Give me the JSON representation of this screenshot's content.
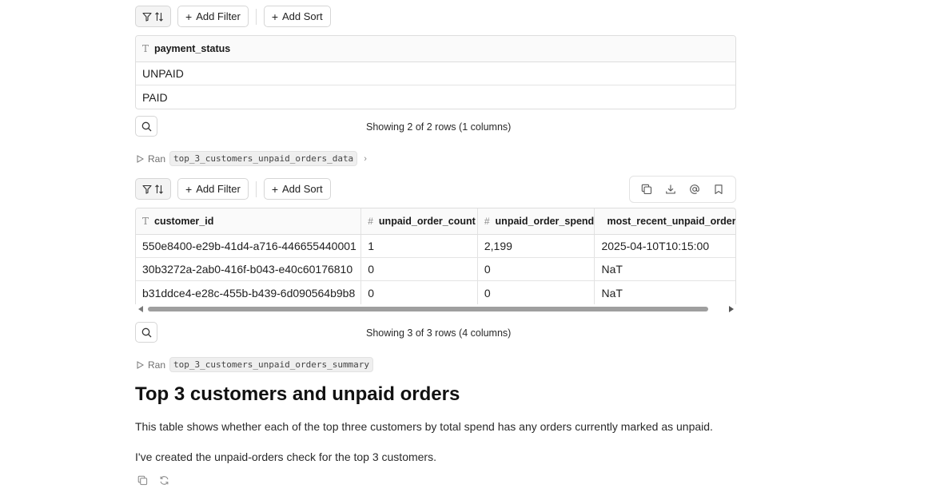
{
  "table1": {
    "toolbar": {
      "add_filter": "Add Filter",
      "add_sort": "Add Sort"
    },
    "column": "payment_status",
    "rows": [
      "UNPAID",
      "PAID"
    ],
    "showing": "Showing 2 of 2 rows (1 columns)"
  },
  "ran1": {
    "label": "Ran",
    "name": "top_3_customers_unpaid_orders_data"
  },
  "table2": {
    "toolbar": {
      "add_filter": "Add Filter",
      "add_sort": "Add Sort"
    },
    "columns": [
      "customer_id",
      "unpaid_order_count",
      "unpaid_order_spend",
      "most_recent_unpaid_order_"
    ],
    "rows": [
      [
        "550e8400-e29b-41d4-a716-446655440001",
        "1",
        "2,199",
        "2025-04-10T10:15:00"
      ],
      [
        "30b3272a-2ab0-416f-b043-e40c60176810",
        "0",
        "0",
        "NaT"
      ],
      [
        "b31ddce4-e28c-455b-b439-6d090564b9b8",
        "0",
        "0",
        "NaT"
      ]
    ],
    "showing": "Showing 3 of 3 rows (4 columns)"
  },
  "ran2": {
    "label": "Ran",
    "name": "top_3_customers_unpaid_orders_summary"
  },
  "summary": {
    "title": "Top 3 customers and unpaid orders",
    "description": "This table shows whether each of the top three customers by total spend has any orders currently marked as unpaid.",
    "note": "I've created the unpaid-orders check for the top 3 customers."
  },
  "icons": {
    "filter_sort": "filter-sort-icon",
    "search": "search-icon",
    "copy": "copy-icon",
    "download": "download-icon",
    "mention": "at-icon",
    "bookmark": "bookmark-icon",
    "regenerate": "refresh-icon",
    "text_type": "text-type-icon",
    "number_type": "hash-icon",
    "date_type": "calendar-icon"
  }
}
